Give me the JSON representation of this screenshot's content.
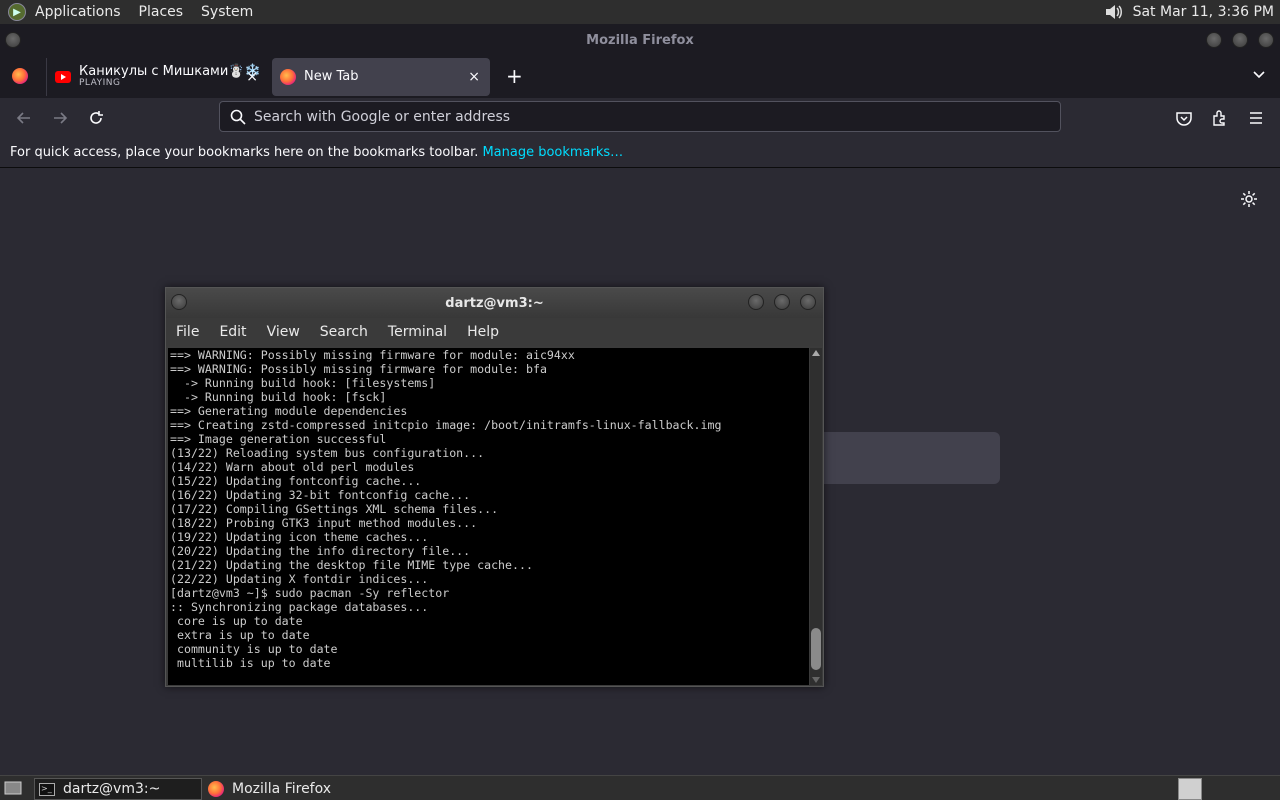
{
  "top_panel": {
    "applications": "Applications",
    "places": "Places",
    "system": "System",
    "clock": "Sat Mar 11,  3:36 PM"
  },
  "firefox": {
    "window_title": "Mozilla Firefox",
    "tabs": [
      {
        "title": "Каникулы с Мишками☃️❄️",
        "subtitle": "PLAYING",
        "close": "×"
      },
      {
        "title": "New Tab",
        "close": "×"
      }
    ],
    "new_tab_symbol": "+",
    "urlbar_placeholder": "Search with Google or enter address",
    "bookmarks_text": "For quick access, place your bookmarks here on the bookmarks toolbar.",
    "bookmarks_link": "Manage bookmarks…"
  },
  "terminal": {
    "title": "dartz@vm3:~",
    "menu": [
      "File",
      "Edit",
      "View",
      "Search",
      "Terminal",
      "Help"
    ],
    "output": "==> WARNING: Possibly missing firmware for module: aic94xx\n==> WARNING: Possibly missing firmware for module: bfa\n  -> Running build hook: [filesystems]\n  -> Running build hook: [fsck]\n==> Generating module dependencies\n==> Creating zstd-compressed initcpio image: /boot/initramfs-linux-fallback.img\n==> Image generation successful\n(13/22) Reloading system bus configuration...\n(14/22) Warn about old perl modules\n(15/22) Updating fontconfig cache...\n(16/22) Updating 32-bit fontconfig cache...\n(17/22) Compiling GSettings XML schema files...\n(18/22) Probing GTK3 input method modules...\n(19/22) Updating icon theme caches...\n(20/22) Updating the info directory file...\n(21/22) Updating the desktop file MIME type cache...\n(22/22) Updating X fontdir indices...\n[dartz@vm3 ~]$ sudo pacman -Sy reflector\n:: Synchronizing package databases...\n core is up to date\n extra is up to date\n community is up to date\n multilib is up to date"
  },
  "taskbar": {
    "items": [
      {
        "label": "dartz@vm3:~"
      },
      {
        "label": "Mozilla Firefox"
      }
    ]
  },
  "icons": {
    "apps_logo": "mate-logo-icon",
    "volume": "speaker-icon",
    "back": "arrow-left-icon",
    "forward": "arrow-right-icon",
    "reload": "reload-icon",
    "search": "magnifier-icon",
    "pocket": "pocket-icon",
    "extensions": "puzzle-icon",
    "menu": "hamburger-icon",
    "settings": "gear-icon"
  }
}
